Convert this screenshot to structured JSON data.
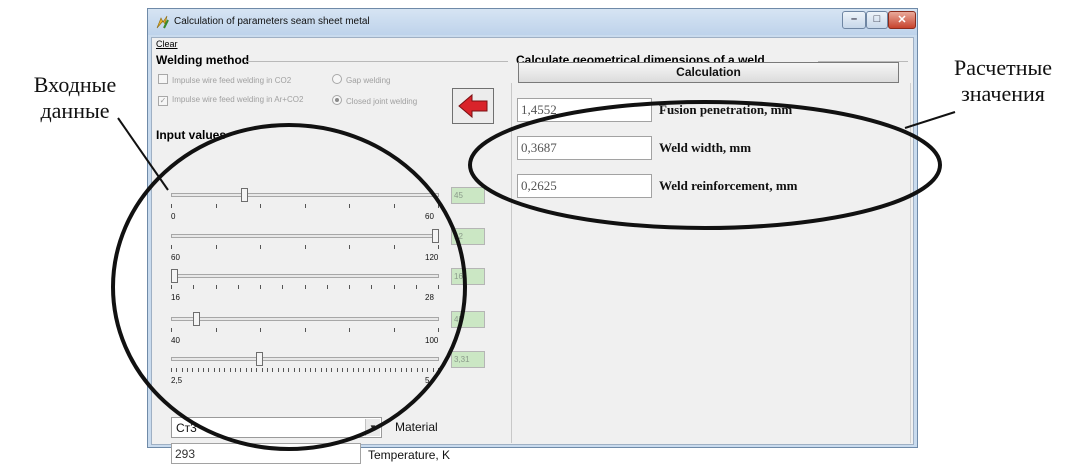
{
  "annotations": {
    "left": [
      "Входные",
      "данные"
    ],
    "right": [
      "Расчетные",
      "значения"
    ]
  },
  "window": {
    "title": "Calculation of  parameters seam sheet  metal",
    "icons": {
      "app": "lightning-app-icon",
      "minimize": "minimize-icon",
      "maximize": "maximize-icon",
      "close": "close-icon"
    }
  },
  "menu": {
    "clear": "Clear"
  },
  "welding_method": {
    "title": "Welding method",
    "options": [
      {
        "label": "Impulse wire feed welding in CO2",
        "type": "checkbox",
        "checked": false
      },
      {
        "label": "Gap welding",
        "type": "radio",
        "checked": false
      },
      {
        "label": "Impulse wire feed welding in Ar+CO2",
        "type": "checkbox",
        "checked": true
      },
      {
        "label": "Closed joint welding",
        "type": "radio",
        "checked": true
      }
    ],
    "arrow_icon": "red-left-arrow-icon"
  },
  "input_values": {
    "title": "Input values",
    "sliders": [
      {
        "min_label": "0",
        "max_label": "60",
        "min": 0,
        "max": 60,
        "value": 16,
        "display": "45",
        "ticks": 7
      },
      {
        "min_label": "60",
        "max_label": "120",
        "min": 60,
        "max": 120,
        "value": 120,
        "display": "12",
        "ticks": 7
      },
      {
        "min_label": "16",
        "max_label": "28",
        "min": 16,
        "max": 28,
        "value": 16,
        "display": "16",
        "ticks": 13
      },
      {
        "min_label": "40",
        "max_label": "100",
        "min": 40,
        "max": 100,
        "value": 45,
        "display": "45",
        "ticks": 7
      },
      {
        "min_label": "2,5",
        "max_label": "5",
        "min": 2.5,
        "max": 5,
        "value": 3.31,
        "display": "3,31",
        "ticks": 51
      }
    ],
    "material": {
      "value": "Ст3",
      "label": "Material"
    },
    "temperature": {
      "value": "293",
      "label": "Temperature, K"
    }
  },
  "calc": {
    "title": "Calculate geometrical dimensions of a weld",
    "button": "Calculation",
    "results": [
      {
        "value": "1,4552",
        "label": "Fusion penetration, mm"
      },
      {
        "value": "0,3687",
        "label": "Weld width, mm"
      },
      {
        "value": "0,2625",
        "label": "Weld reinforcement, mm"
      }
    ]
  }
}
